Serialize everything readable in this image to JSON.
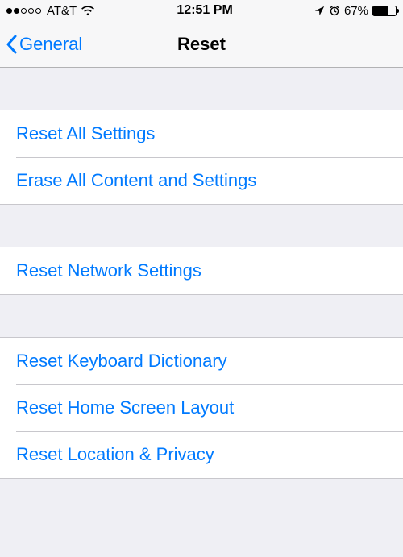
{
  "status": {
    "signal_filled": 2,
    "signal_total": 5,
    "carrier": "AT&T",
    "time": "12:51 PM",
    "battery_pct": "67%",
    "battery_fill_pct": 67
  },
  "nav": {
    "back_label": "General",
    "title": "Reset"
  },
  "groups": [
    {
      "items": [
        {
          "label": "Reset All Settings"
        },
        {
          "label": "Erase All Content and Settings"
        }
      ]
    },
    {
      "items": [
        {
          "label": "Reset Network Settings"
        }
      ]
    },
    {
      "items": [
        {
          "label": "Reset Keyboard Dictionary"
        },
        {
          "label": "Reset Home Screen Layout"
        },
        {
          "label": "Reset Location & Privacy"
        }
      ]
    }
  ]
}
